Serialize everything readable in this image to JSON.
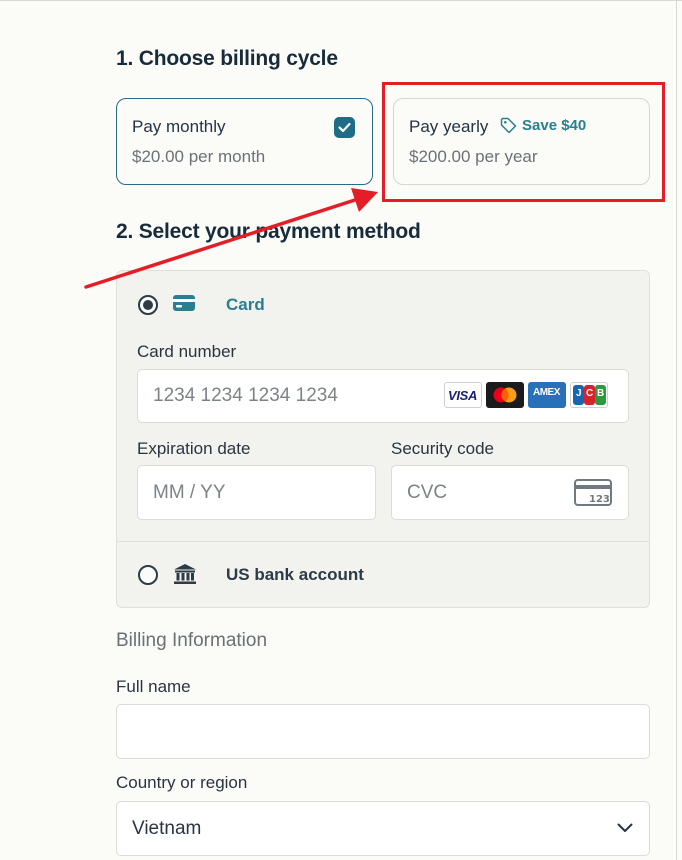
{
  "billing_cycle": {
    "title": "1. Choose billing cycle",
    "monthly": {
      "name": "Pay monthly",
      "price": "$20.00 per month",
      "selected": true
    },
    "yearly": {
      "name": "Pay yearly",
      "badge": "Save $40",
      "price": "$200.00 per year",
      "selected": false
    }
  },
  "payment": {
    "title": "2. Select your payment method",
    "methods": [
      {
        "label": "Card",
        "icon": "credit-card-icon",
        "selected": true
      },
      {
        "label": "US bank account",
        "icon": "bank-icon",
        "selected": false
      }
    ],
    "card_number": {
      "label": "Card number",
      "placeholder": "1234 1234 1234 1234"
    },
    "card_brands": [
      "VISA",
      "Mastercard",
      "AMEX",
      "JCB"
    ],
    "expiration": {
      "label": "Expiration date",
      "placeholder": "MM / YY"
    },
    "security": {
      "label": "Security code",
      "placeholder": "CVC",
      "icon_text": "123"
    }
  },
  "billing_info": {
    "title": "Billing Information",
    "full_name": {
      "label": "Full name",
      "value": ""
    },
    "country": {
      "label": "Country or region",
      "value": "Vietnam"
    }
  },
  "annotation": {
    "color": "#e41e26"
  },
  "colors": {
    "accent": "#1f6c86",
    "accent_text": "#2a7f8e",
    "text": "#172b3a"
  }
}
